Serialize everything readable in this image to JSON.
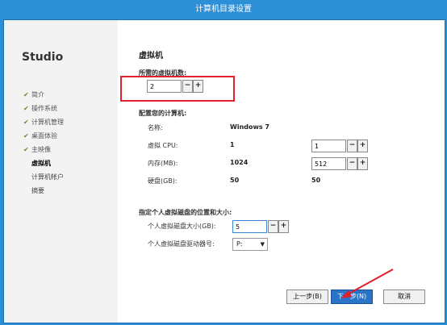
{
  "window": {
    "title": "计算机目录设置"
  },
  "sidebar": {
    "brand": "Studio",
    "items": [
      {
        "label": "简介",
        "state": "done"
      },
      {
        "label": "操作系统",
        "state": "done"
      },
      {
        "label": "计算机管理",
        "state": "done"
      },
      {
        "label": "桌面体验",
        "state": "done"
      },
      {
        "label": "主映像",
        "state": "done"
      },
      {
        "label": "虚拟机",
        "state": "current"
      },
      {
        "label": "计算机帐户",
        "state": "pending"
      },
      {
        "label": "摘要",
        "state": "pending"
      }
    ],
    "check_icon": "checkmark-icon"
  },
  "main": {
    "heading": "虚拟机",
    "vm_count": {
      "label": "所需的虚拟机数:",
      "value": "2"
    },
    "config": {
      "title": "配置您的计算机:",
      "name_label": "名称:",
      "name_value": "Windows 7",
      "cpu_label": "虚拟 CPU:",
      "cpu_default": "1",
      "cpu_value": "1",
      "mem_label": "内存(MB):",
      "mem_default": "1024",
      "mem_value": "512",
      "disk_label": "硬盘(GB):",
      "disk_default": "50",
      "disk_value": "50"
    },
    "personal": {
      "title": "指定个人虚拟磁盘的位置和大小:",
      "size_label": "个人虚拟磁盘大小(GB):",
      "size_value": "5",
      "drive_label": "个人虚拟磁盘驱动器号:",
      "drive_value": "P:"
    },
    "stepper": {
      "minus": "−",
      "plus": "+"
    },
    "buttons": {
      "back": "上一步(B)",
      "next": "下一步(N)",
      "cancel": "取消"
    }
  },
  "colors": {
    "accent": "#2a74c8",
    "highlight": "#e0202a",
    "check": "#5c8f3a"
  }
}
